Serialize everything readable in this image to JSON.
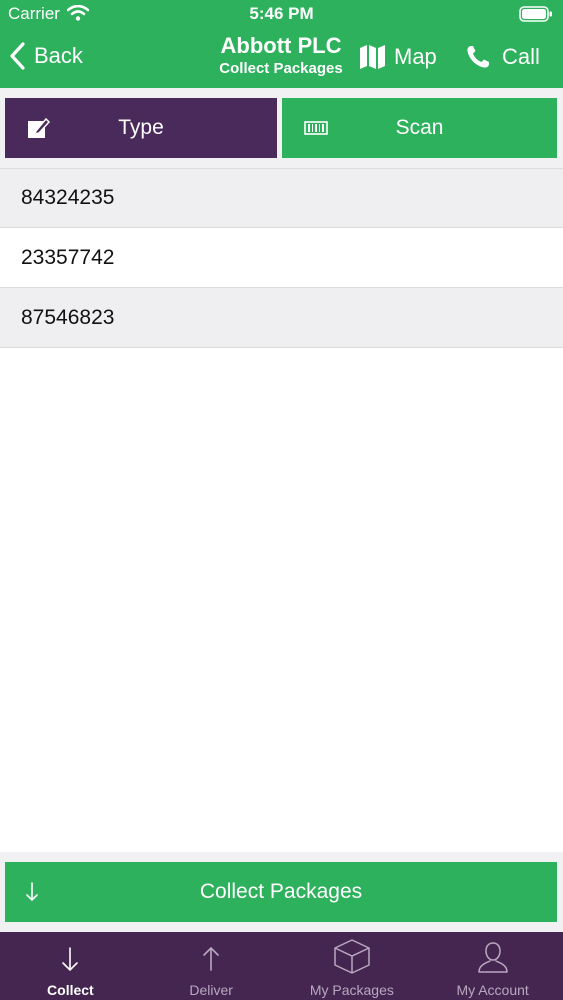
{
  "status_bar": {
    "carrier": "Carrier",
    "time": "5:46 PM"
  },
  "nav": {
    "back_label": "Back",
    "title": "Abbott PLC",
    "subtitle": "Collect Packages",
    "map_label": "Map",
    "call_label": "Call"
  },
  "mode": {
    "type_label": "Type",
    "scan_label": "Scan"
  },
  "packages": [
    "84324235",
    "23357742",
    "87546823"
  ],
  "action": {
    "collect_label": "Collect Packages"
  },
  "tabs": [
    {
      "label": "Collect",
      "icon": "arrow-down-icon",
      "active": true
    },
    {
      "label": "Deliver",
      "icon": "arrow-up-icon",
      "active": false
    },
    {
      "label": "My Packages",
      "icon": "box-icon",
      "active": false
    },
    {
      "label": "My Account",
      "icon": "person-icon",
      "active": false
    }
  ],
  "colors": {
    "primary_green": "#2db15c",
    "purple": "#4a2a5a",
    "tabbar_purple": "#452650"
  }
}
